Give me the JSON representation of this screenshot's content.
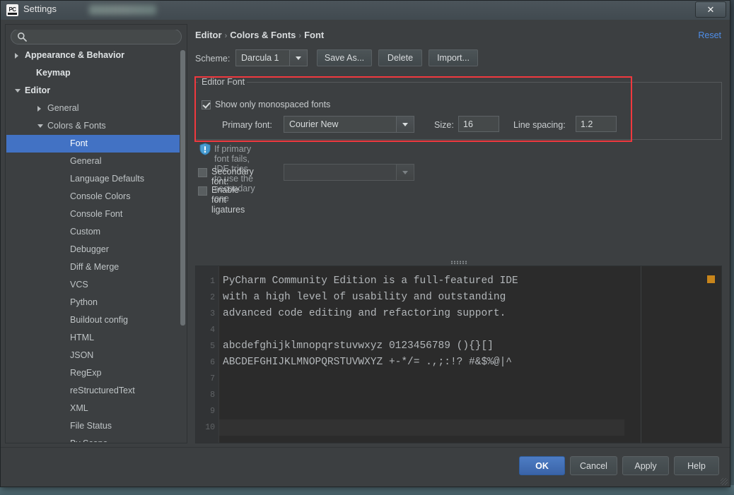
{
  "window": {
    "title": "Settings",
    "app_icon": "pycharm-icon",
    "close_label": "✕"
  },
  "search": {
    "value": "",
    "placeholder": "",
    "icon": "search-icon"
  },
  "sidebar": {
    "items": [
      {
        "label": "Appearance & Behavior",
        "indent": 8,
        "arrow": "closed",
        "bold": true,
        "selected": false,
        "clipped": true
      },
      {
        "label": "Keymap",
        "indent": 24,
        "arrow": "none",
        "bold": true,
        "selected": false
      },
      {
        "label": "Editor",
        "indent": 8,
        "arrow": "open",
        "bold": true,
        "selected": false
      },
      {
        "label": "General",
        "indent": 40,
        "arrow": "closed",
        "bold": false,
        "selected": false
      },
      {
        "label": "Colors & Fonts",
        "indent": 40,
        "arrow": "open",
        "bold": false,
        "selected": false
      },
      {
        "label": "Font",
        "indent": 72,
        "arrow": "none",
        "bold": false,
        "selected": true
      },
      {
        "label": "General",
        "indent": 72,
        "arrow": "none",
        "bold": false,
        "selected": false
      },
      {
        "label": "Language Defaults",
        "indent": 72,
        "arrow": "none",
        "bold": false,
        "selected": false
      },
      {
        "label": "Console Colors",
        "indent": 72,
        "arrow": "none",
        "bold": false,
        "selected": false
      },
      {
        "label": "Console Font",
        "indent": 72,
        "arrow": "none",
        "bold": false,
        "selected": false
      },
      {
        "label": "Custom",
        "indent": 72,
        "arrow": "none",
        "bold": false,
        "selected": false
      },
      {
        "label": "Debugger",
        "indent": 72,
        "arrow": "none",
        "bold": false,
        "selected": false
      },
      {
        "label": "Diff & Merge",
        "indent": 72,
        "arrow": "none",
        "bold": false,
        "selected": false
      },
      {
        "label": "VCS",
        "indent": 72,
        "arrow": "none",
        "bold": false,
        "selected": false
      },
      {
        "label": "Python",
        "indent": 72,
        "arrow": "none",
        "bold": false,
        "selected": false
      },
      {
        "label": "Buildout config",
        "indent": 72,
        "arrow": "none",
        "bold": false,
        "selected": false
      },
      {
        "label": "HTML",
        "indent": 72,
        "arrow": "none",
        "bold": false,
        "selected": false
      },
      {
        "label": "JSON",
        "indent": 72,
        "arrow": "none",
        "bold": false,
        "selected": false
      },
      {
        "label": "RegExp",
        "indent": 72,
        "arrow": "none",
        "bold": false,
        "selected": false
      },
      {
        "label": "reStructuredText",
        "indent": 72,
        "arrow": "none",
        "bold": false,
        "selected": false
      },
      {
        "label": "XML",
        "indent": 72,
        "arrow": "none",
        "bold": false,
        "selected": false
      },
      {
        "label": "File Status",
        "indent": 72,
        "arrow": "none",
        "bold": false,
        "selected": false
      },
      {
        "label": "By Scope",
        "indent": 72,
        "arrow": "none",
        "bold": false,
        "selected": false
      }
    ]
  },
  "breadcrumb": {
    "part1": "Editor",
    "part2": "Colors & Fonts",
    "part3": "Font",
    "separator": "›"
  },
  "reset": {
    "label": "Reset"
  },
  "scheme": {
    "label": "Scheme:",
    "value": "Darcula 1",
    "save_as": "Save As...",
    "delete": "Delete",
    "import": "Import..."
  },
  "editor_font": {
    "group_title": "Editor Font",
    "monospaced_label": "Show only monospaced fonts",
    "monospaced_checked": true,
    "primary_label": "Primary font:",
    "primary_value": "Courier New",
    "size_label": "Size:",
    "size_value": "16",
    "line_spacing_label": "Line spacing:",
    "line_spacing_value": "1.2",
    "highlight_color": "#f0383e"
  },
  "hint": {
    "icon": "info-shield-icon",
    "text": "If primary font fails, IDE tries to use the secondary one"
  },
  "secondary": {
    "label": "Secondary font:",
    "value": "",
    "checked": false
  },
  "ligatures": {
    "label": "Enable font ligatures",
    "checked": false
  },
  "preview": {
    "line_numbers": [
      "1",
      "2",
      "3",
      "4",
      "5",
      "6",
      "7",
      "8",
      "9",
      "10"
    ],
    "lines": [
      "PyCharm Community Edition is a full-featured IDE",
      "with a high level of usability and outstanding",
      "advanced code editing and refactoring support.",
      "",
      "abcdefghijklmnopqrstuvwxyz 0123456789 (){}[]",
      "ABCDEFGHIJKLMNOPQRSTUVWXYZ +-*/= .,;:!? #&$%@|^",
      "",
      "",
      "",
      ""
    ],
    "caret_line": 10,
    "marker_color": "#c8851b",
    "background": "#2b2b2b",
    "text_color": "#b3b7ba"
  },
  "footer": {
    "ok": "OK",
    "cancel": "Cancel",
    "apply": "Apply",
    "help": "Help"
  }
}
